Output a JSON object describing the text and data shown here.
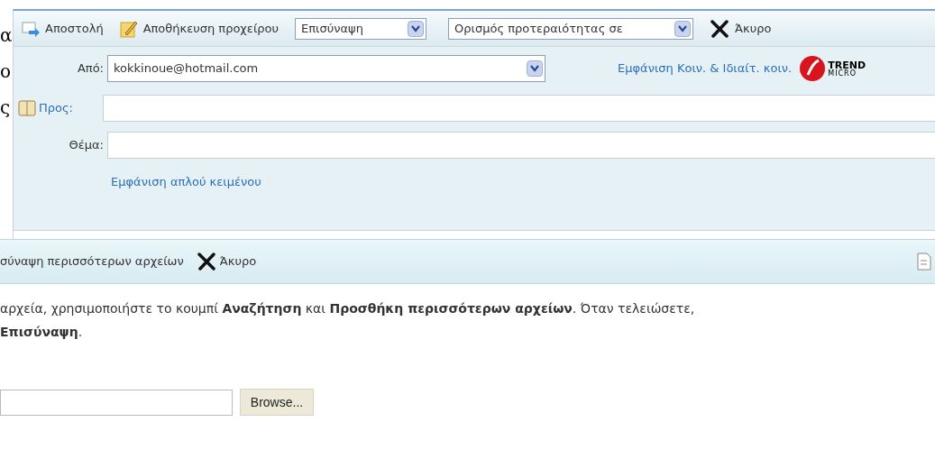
{
  "side_fragments": [
    "α",
    "ο",
    "ς"
  ],
  "toolbar": {
    "send": "Αποστολή",
    "save_draft": "Αποθήκευση προχείρου",
    "attach_dropdown": "Επισύναψη",
    "priority_dropdown": "Ορισμός προτεραιότητας σε",
    "cancel": "Άκυρο"
  },
  "compose": {
    "from_label": "Από:",
    "from_value": "kokkinoue@hotmail.com",
    "show_cc_link": "Εμφάνιση Κοιν. & Ιδιαίτ. κοιν.",
    "to_label": "Προς:",
    "subject_label": "Θέμα:",
    "plain_text_link": "Εμφάνιση απλού κειμένου",
    "logo_text": "TREND",
    "logo_subtext": "MICRO"
  },
  "attach_panel": {
    "add_more": "σύναψη περισσότερων αρχείων",
    "cancel": "Άκυρο",
    "instructions": "αρχεία, χρησιμοποιήστε το κουμπί **Αναζήτηση** και **Προσθήκη περισσότερων αρχείων**. Όταν τελειώσετε,",
    "instructions_2": "**Επισύναψη**.",
    "browse": "Browse..."
  }
}
